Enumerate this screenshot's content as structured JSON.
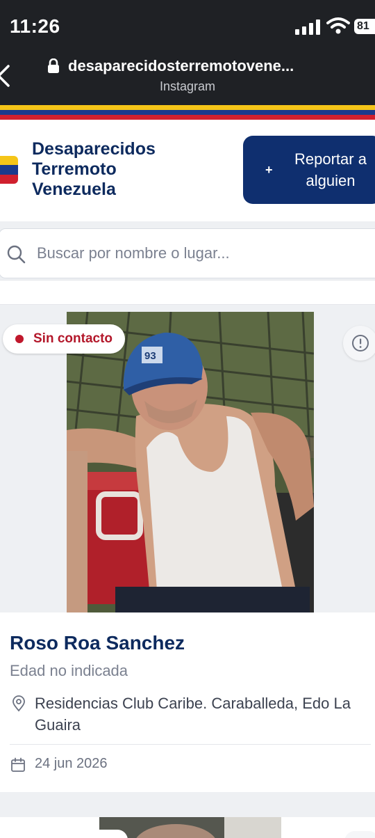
{
  "status_bar": {
    "time": "11:26",
    "battery": "81"
  },
  "browser": {
    "url": "desaparecidosterremotovene...",
    "source": "Instagram"
  },
  "colors": {
    "flag_yellow": "#f5c518",
    "flag_blue": "#1a3a8c",
    "flag_red": "#d0202e",
    "brand_navy": "#0d2a5e",
    "button_navy": "#0f2f6f",
    "status_red": "#c0182c"
  },
  "header": {
    "brand_line1": "Desaparecidos",
    "brand_line2": "Terremoto",
    "brand_line3": "Venezuela",
    "report_plus": "+",
    "report_label": "Reportar a alguien"
  },
  "search": {
    "placeholder": "Buscar por nombre o lugar...",
    "icon": "search-icon"
  },
  "cards": [
    {
      "status": "Sin contacto",
      "name": "Roso Roa Sanchez",
      "age": "Edad no indicada",
      "location": "Residencias Club Caribe. Caraballeda, Edo La Guaira",
      "date": "24 jun 2026",
      "icons": [
        "info-icon",
        "location-pin-icon",
        "calendar-icon"
      ]
    }
  ]
}
